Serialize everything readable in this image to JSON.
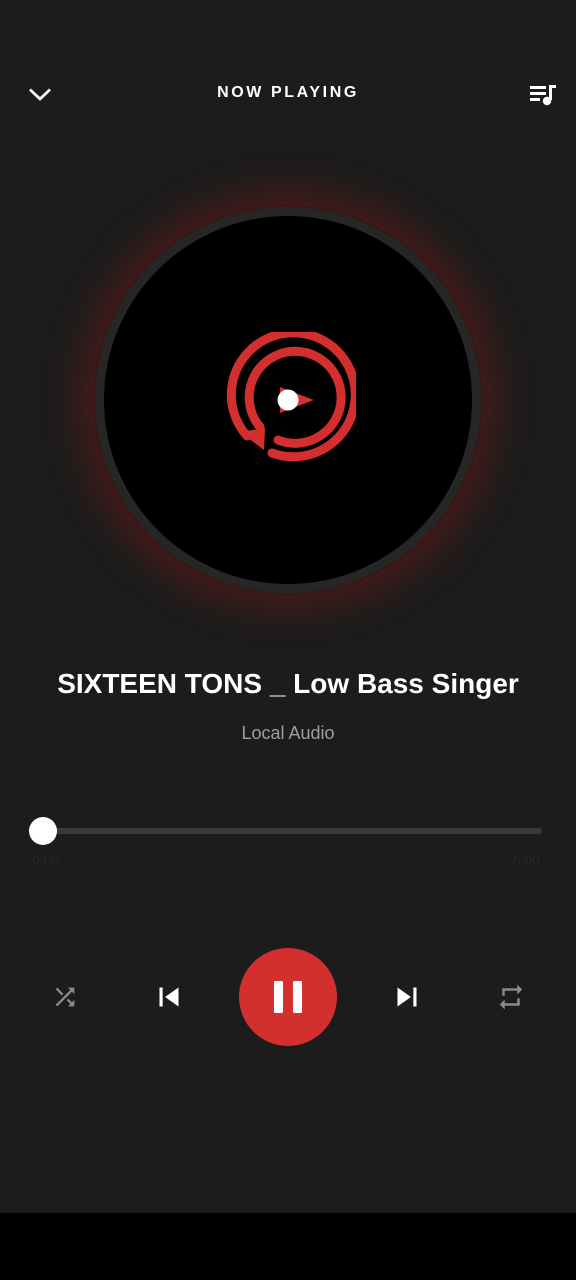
{
  "header": {
    "title": "NOW PLAYING",
    "collapse_icon": "chevron-down-icon",
    "queue_icon": "playlist-music-icon"
  },
  "album_art": {
    "icon": "app-logo-icon"
  },
  "track": {
    "title": "SIXTEEN TONS _ Low Bass Singer",
    "artist": "Local Audio"
  },
  "progress": {
    "position_fraction": 0.0,
    "elapsed": "0:00",
    "duration": "5:00"
  },
  "controls": {
    "shuffle_icon": "shuffle-icon",
    "previous_icon": "skip-previous-icon",
    "play_pause_icon": "pause-icon",
    "next_icon": "skip-next-icon",
    "repeat_icon": "repeat-icon",
    "state": "playing"
  },
  "colors": {
    "background": "#1c1c1c",
    "accent": "#d32f2f",
    "secondary_text": "#9e9e9e",
    "track_bg": "#3a3a3a"
  }
}
